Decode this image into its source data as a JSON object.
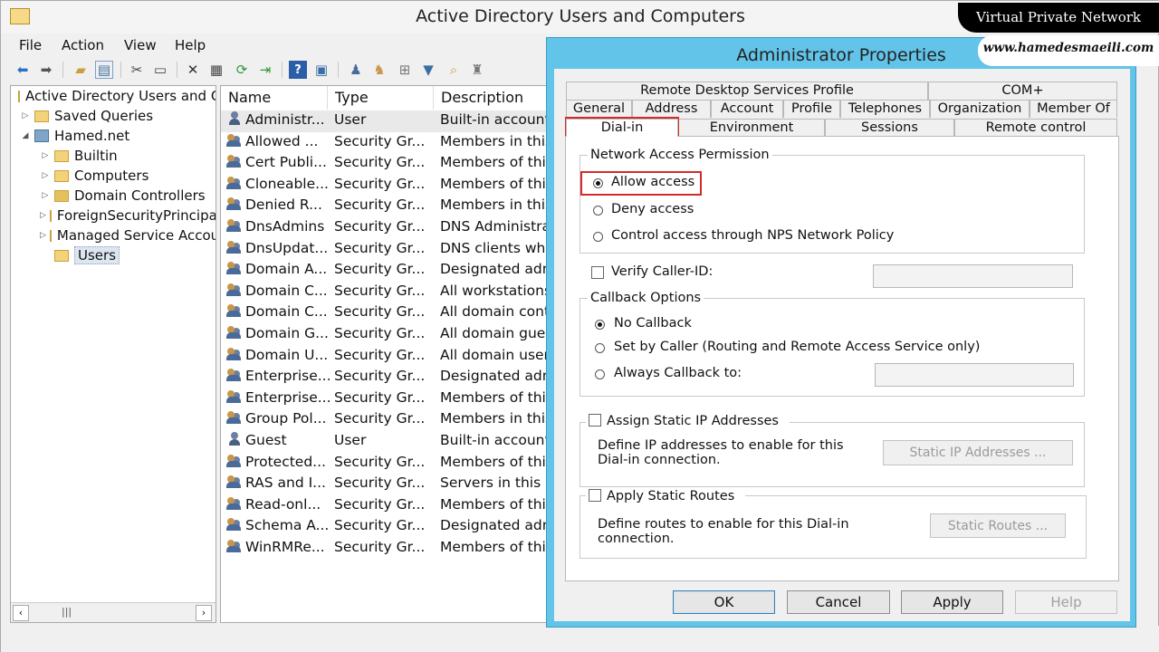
{
  "app": {
    "title": "Active Directory Users and Computers",
    "menu": [
      "File",
      "Action",
      "View",
      "Help"
    ]
  },
  "toolbar": {
    "icons": [
      "back-arrow-icon",
      "forward-arrow-icon",
      "up-folder-icon",
      "show-console-tree-icon",
      "cut-icon",
      "copy-icon",
      "delete-icon",
      "properties-icon",
      "refresh-icon",
      "export-list-icon",
      "help-icon",
      "mmc-icon",
      "new-user-icon",
      "new-group-icon",
      "new-ou-icon",
      "filter-icon",
      "find-icon",
      "add-to-group-icon"
    ]
  },
  "tree": {
    "items": [
      {
        "label": "Active Directory Users and Computers",
        "level": 0,
        "icon": "console-icon"
      },
      {
        "label": "Saved Queries",
        "level": 1,
        "icon": "folder-icon"
      },
      {
        "label": "Hamed.net",
        "level": 1,
        "icon": "domain-icon",
        "expanded": true
      },
      {
        "label": "Builtin",
        "level": 2,
        "icon": "folder-icon"
      },
      {
        "label": "Computers",
        "level": 2,
        "icon": "folder-icon"
      },
      {
        "label": "Domain Controllers",
        "level": 2,
        "icon": "ou-icon"
      },
      {
        "label": "ForeignSecurityPrincipals",
        "level": 2,
        "icon": "folder-icon"
      },
      {
        "label": "Managed Service Accounts",
        "level": 2,
        "icon": "folder-icon"
      },
      {
        "label": "Users",
        "level": 2,
        "icon": "folder-icon",
        "selected": true
      }
    ]
  },
  "list": {
    "columns": [
      "Name",
      "Type",
      "Description"
    ],
    "rows": [
      {
        "name": "Administr...",
        "type": "User",
        "desc": "Built-in account",
        "icon": "user"
      },
      {
        "name": "Allowed ...",
        "type": "Security Gr...",
        "desc": "Members in this",
        "icon": "group"
      },
      {
        "name": "Cert Publi...",
        "type": "Security Gr...",
        "desc": "Members of this",
        "icon": "group"
      },
      {
        "name": "Cloneable...",
        "type": "Security Gr...",
        "desc": "Members of this",
        "icon": "group"
      },
      {
        "name": "Denied R...",
        "type": "Security Gr...",
        "desc": "Members in this",
        "icon": "group"
      },
      {
        "name": "DnsAdmins",
        "type": "Security Gr...",
        "desc": "DNS Administra",
        "icon": "group"
      },
      {
        "name": "DnsUpdat...",
        "type": "Security Gr...",
        "desc": "DNS clients whe",
        "icon": "group"
      },
      {
        "name": "Domain A...",
        "type": "Security Gr...",
        "desc": "Designated adm",
        "icon": "group"
      },
      {
        "name": "Domain C...",
        "type": "Security Gr...",
        "desc": "All workstations",
        "icon": "group"
      },
      {
        "name": "Domain C...",
        "type": "Security Gr...",
        "desc": "All domain cont",
        "icon": "group"
      },
      {
        "name": "Domain G...",
        "type": "Security Gr...",
        "desc": "All domain gue",
        "icon": "group"
      },
      {
        "name": "Domain U...",
        "type": "Security Gr...",
        "desc": "All domain user",
        "icon": "group"
      },
      {
        "name": "Enterprise...",
        "type": "Security Gr...",
        "desc": "Designated adm",
        "icon": "group"
      },
      {
        "name": "Enterprise...",
        "type": "Security Gr...",
        "desc": "Members of this",
        "icon": "group"
      },
      {
        "name": "Group Pol...",
        "type": "Security Gr...",
        "desc": "Members in this",
        "icon": "group"
      },
      {
        "name": "Guest",
        "type": "User",
        "desc": "Built-in account",
        "icon": "user"
      },
      {
        "name": "Protected...",
        "type": "Security Gr...",
        "desc": "Members of this",
        "icon": "group"
      },
      {
        "name": "RAS and I...",
        "type": "Security Gr...",
        "desc": "Servers in this g",
        "icon": "group"
      },
      {
        "name": "Read-onl...",
        "type": "Security Gr...",
        "desc": "Members of this",
        "icon": "group"
      },
      {
        "name": "Schema A...",
        "type": "Security Gr...",
        "desc": "Designated adm",
        "icon": "group"
      },
      {
        "name": "WinRMRe...",
        "type": "Security Gr...",
        "desc": "Members of this",
        "icon": "group"
      }
    ]
  },
  "dialog": {
    "title": "Administrator Properties",
    "tabs_row1": [
      "Remote Desktop Services Profile",
      "COM+"
    ],
    "tabs_row2": [
      "General",
      "Address",
      "Account",
      "Profile",
      "Telephones",
      "Organization",
      "Member Of"
    ],
    "tabs_row3": [
      "Dial-in",
      "Environment",
      "Sessions",
      "Remote control"
    ],
    "active_tab": "Dial-in",
    "network_access": {
      "title": "Network Access Permission",
      "options": [
        "Allow access",
        "Deny access",
        "Control access through NPS Network Policy"
      ],
      "selected": "Allow access"
    },
    "verify_caller_id": {
      "label": "Verify Caller-ID:",
      "checked": false,
      "value": ""
    },
    "callback": {
      "title": "Callback Options",
      "options": [
        "No Callback",
        "Set by Caller (Routing and Remote Access Service only)",
        "Always Callback to:"
      ],
      "selected": "No Callback",
      "always_value": ""
    },
    "static_ip": {
      "label": "Assign Static IP Addresses",
      "checked": false,
      "desc_line1": "Define IP addresses to enable for this",
      "desc_line2": "Dial-in connection.",
      "button": "Static IP Addresses ..."
    },
    "static_routes": {
      "label": "Apply Static Routes",
      "checked": false,
      "desc_line1": "Define routes to enable for this Dial-in",
      "desc_line2": "connection.",
      "button": "Static Routes ..."
    },
    "buttons": {
      "ok": "OK",
      "cancel": "Cancel",
      "apply": "Apply",
      "help": "Help"
    }
  },
  "watermark": {
    "line1": "Virtual Private Network",
    "line2": "www.hamedesmaeili.com"
  },
  "colors": {
    "dialog_frame": "#62c4e8",
    "highlight": "#d42a2a"
  }
}
